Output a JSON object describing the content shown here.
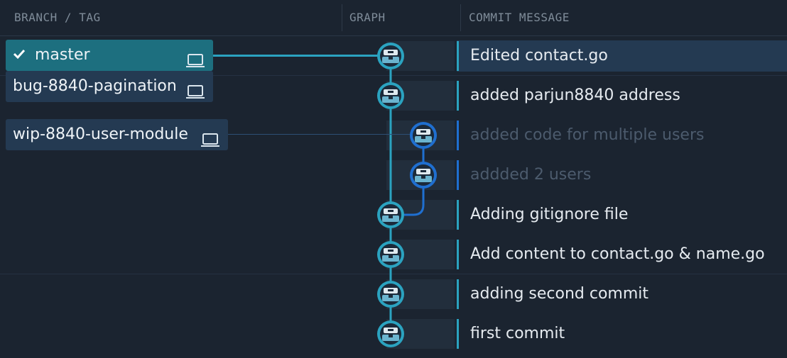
{
  "header": {
    "branch_col": "BRANCH / TAG",
    "graph_col": "GRAPH",
    "message_col": "COMMIT MESSAGE"
  },
  "branches": [
    {
      "name": "master",
      "active": true,
      "checked": true,
      "icon": "laptop-icon"
    },
    {
      "name": "bug-8840-pagination",
      "active": false,
      "checked": false,
      "icon": "laptop-icon"
    },
    {
      "name": "wip-8840-user-module",
      "active": false,
      "checked": false,
      "icon": "laptop-icon"
    }
  ],
  "commits": [
    {
      "message": "Edited contact.go",
      "lane": "main",
      "selected": true,
      "dim": false
    },
    {
      "message": "added parjun8840 address",
      "lane": "main",
      "selected": false,
      "dim": false
    },
    {
      "message": "added code for multiple users",
      "lane": "wip",
      "selected": false,
      "dim": true
    },
    {
      "message": "addded 2 users",
      "lane": "wip",
      "selected": false,
      "dim": true
    },
    {
      "message": "Adding gitignore file",
      "lane": "main",
      "selected": false,
      "dim": false
    },
    {
      "message": "Add content to contact.go & name.go",
      "lane": "main",
      "selected": false,
      "dim": false
    },
    {
      "message": "adding second commit",
      "lane": "main",
      "selected": false,
      "dim": false
    },
    {
      "message": "first commit",
      "lane": "main",
      "selected": false,
      "dim": false
    }
  ],
  "colors": {
    "background": "#1b2430",
    "main_lane": "#2ba3c0",
    "wip_lane": "#1f6fd0",
    "active_branch": "#1d6f7f",
    "branch_bg": "#243a52"
  }
}
